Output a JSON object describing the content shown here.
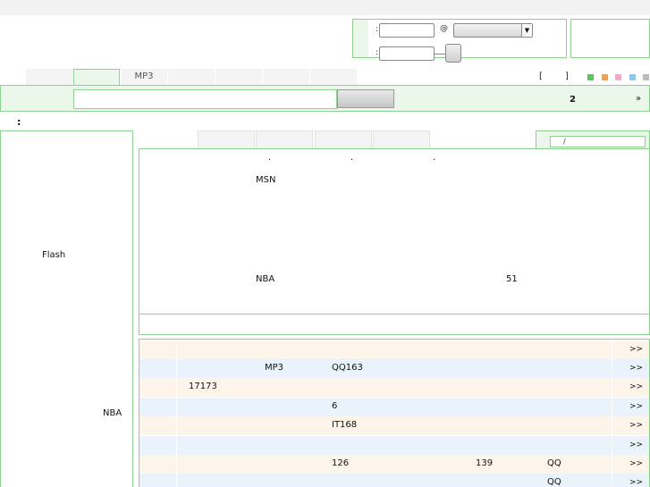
{
  "login": {
    "colon_1": ":",
    "colon_2": ":",
    "at_sign": "@"
  },
  "tabs": [
    {
      "label": ""
    },
    {
      "label": ""
    },
    {
      "label": "MP3"
    },
    {
      "label": ""
    },
    {
      "label": ""
    },
    {
      "label": ""
    },
    {
      "label": ""
    }
  ],
  "skin": {
    "bracket_open": "[",
    "bracket_close": "]",
    "colors": [
      "#55c855",
      "#f5a043",
      "#f4a7c8",
      "#8cc8ee",
      "#bbbbbb"
    ]
  },
  "search": {
    "page_number": "2",
    "next_label": "»"
  },
  "section_colon": ":",
  "sidebar": {
    "item_flash": "Flash",
    "item_nba": "NBA"
  },
  "news_tabs": {
    "search_slash": "/"
  },
  "news": {
    "dots": [
      ".",
      ".",
      "."
    ],
    "msn": "MSN",
    "nba": "NBA",
    "num_51": "51"
  },
  "list": {
    "more_label": ">>",
    "rows": [
      {
        "cells": []
      },
      {
        "cells": [
          {
            "text": "MP3",
            "pos": "a"
          },
          {
            "text": "QQ163",
            "pos": "b"
          }
        ]
      },
      {
        "cells": [
          {
            "text": "17173",
            "pos": "start"
          }
        ]
      },
      {
        "cells": [
          {
            "text": "6",
            "pos": "b"
          }
        ]
      },
      {
        "cells": [
          {
            "text": "IT168",
            "pos": "b"
          }
        ]
      },
      {
        "cells": []
      },
      {
        "cells": [
          {
            "text": "126",
            "pos": "b"
          },
          {
            "text": "139",
            "pos": "c"
          },
          {
            "text": "QQ",
            "pos": "d"
          }
        ]
      },
      {
        "cells": [
          {
            "text": "QQ",
            "pos": "d"
          }
        ]
      }
    ]
  }
}
